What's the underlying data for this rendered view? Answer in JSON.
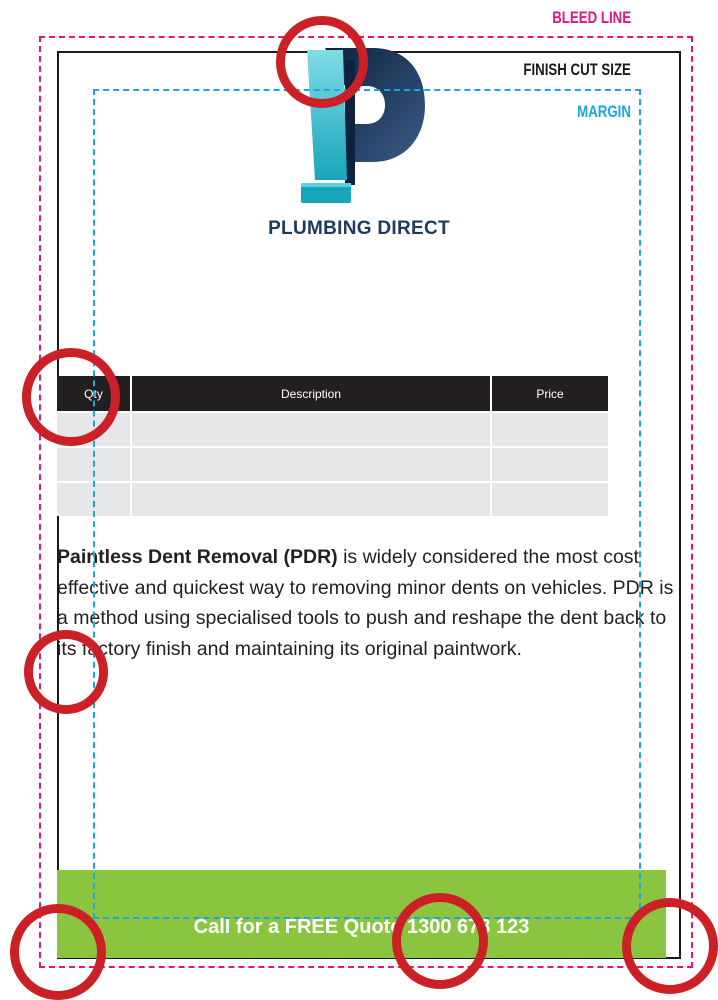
{
  "guides": {
    "bleed_label": "BLEED LINE",
    "cut_label": "FINISH CUT SIZE",
    "margin_label": "MARGIN",
    "bleed_color": "#e0157f",
    "cut_color": "#1a1a1a",
    "margin_color": "#1aa7e0"
  },
  "logo": {
    "icon": "p-letter-logo-icon",
    "brand_name": "PLUMBING DIRECT",
    "brand_color": "#1d3b5c",
    "pipe_color": "#2bbfd1"
  },
  "table": {
    "headers": [
      "Qty",
      "Description",
      "Price"
    ],
    "rows": [
      [
        "",
        "",
        ""
      ],
      [
        "",
        "",
        ""
      ],
      [
        "",
        "",
        ""
      ]
    ]
  },
  "body": {
    "bold_intro": "Paintless Dent Removal (PDR)",
    "text": " is widely considered the most cost effective and quickest way to removing minor dents on vehicles. PDR is a method using specialised tools to push and reshape the dent back to its factory finish and maintaining its original paintwork."
  },
  "cta": {
    "text": "Call for a FREE Quote 1300 678 123",
    "color": "#8bc53f"
  },
  "annotations": {
    "color": "#cc2027",
    "count": 7
  }
}
